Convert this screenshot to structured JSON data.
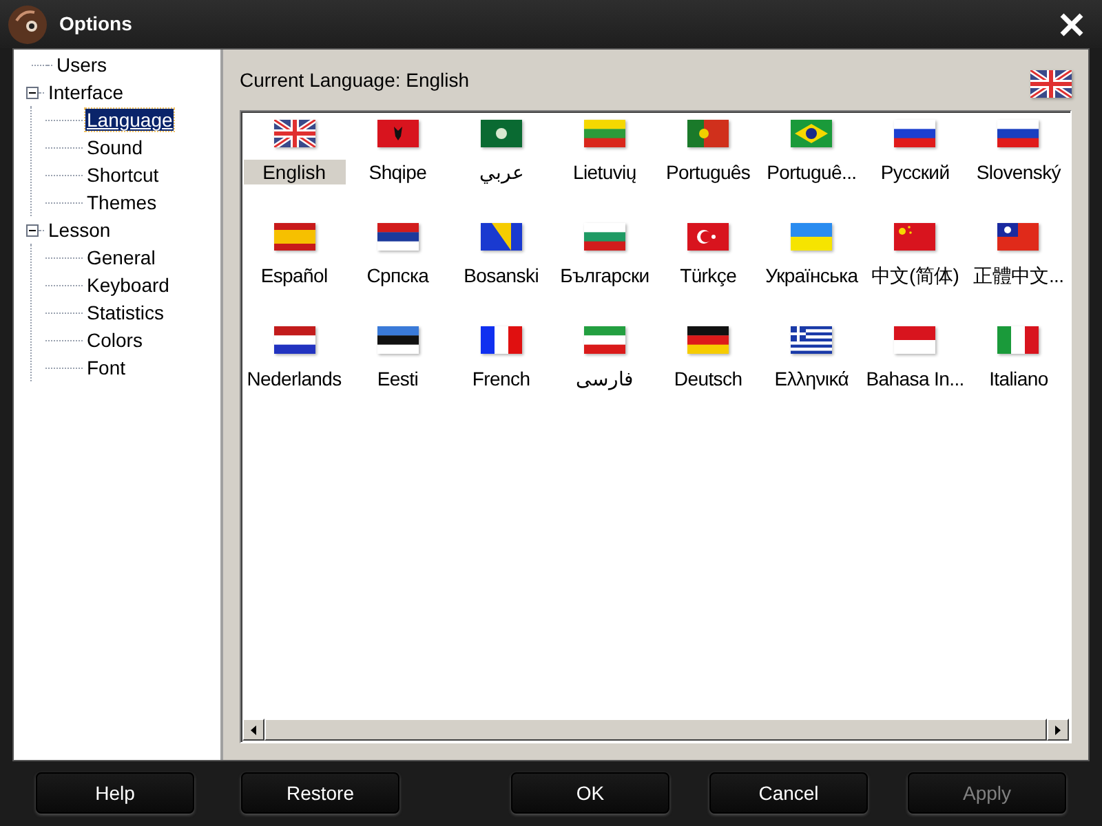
{
  "window": {
    "title": "Options"
  },
  "tree": [
    {
      "label": "Users",
      "selected": false
    },
    {
      "label": "Interface",
      "selected": false,
      "expanded": true,
      "children": [
        {
          "label": "Language",
          "selected": true
        },
        {
          "label": "Sound",
          "selected": false
        },
        {
          "label": "Shortcut",
          "selected": false
        },
        {
          "label": "Themes",
          "selected": false
        }
      ]
    },
    {
      "label": "Lesson",
      "selected": false,
      "expanded": true,
      "children": [
        {
          "label": "General",
          "selected": false
        },
        {
          "label": "Keyboard",
          "selected": false
        },
        {
          "label": "Statistics",
          "selected": false
        },
        {
          "label": "Colors",
          "selected": false
        },
        {
          "label": "Font",
          "selected": false
        }
      ]
    }
  ],
  "current_language": "Current Language: English",
  "languages": [
    {
      "label": "English",
      "selected": true
    },
    {
      "label": "Shqipe",
      "selected": false
    },
    {
      "label": "عربي",
      "selected": false
    },
    {
      "label": "Lietuvių",
      "selected": false
    },
    {
      "label": "Português",
      "selected": false
    },
    {
      "label": "Portuguê...",
      "selected": false
    },
    {
      "label": "Русский",
      "selected": false
    },
    {
      "label": "Slovenský",
      "selected": false
    },
    {
      "label": "Español",
      "selected": false
    },
    {
      "label": "Српска",
      "selected": false
    },
    {
      "label": "Bosanski",
      "selected": false
    },
    {
      "label": "Български",
      "selected": false
    },
    {
      "label": "Türkçe",
      "selected": false
    },
    {
      "label": "Українська",
      "selected": false
    },
    {
      "label": "中文(简体)",
      "selected": false
    },
    {
      "label": "正體中文...",
      "selected": false
    },
    {
      "label": "Nederlands",
      "selected": false
    },
    {
      "label": "Eesti",
      "selected": false
    },
    {
      "label": "French",
      "selected": false
    },
    {
      "label": "فارسی",
      "selected": false
    },
    {
      "label": "Deutsch",
      "selected": false
    },
    {
      "label": "Ελληνικά",
      "selected": false
    },
    {
      "label": "Bahasa In...",
      "selected": false
    },
    {
      "label": "Italiano",
      "selected": false
    }
  ],
  "buttons": [
    {
      "label": "Help",
      "disabled": false
    },
    {
      "label": "Restore",
      "disabled": false
    },
    {
      "label": "OK",
      "disabled": false
    },
    {
      "label": "Cancel",
      "disabled": false
    },
    {
      "label": "Apply",
      "disabled": true
    }
  ]
}
